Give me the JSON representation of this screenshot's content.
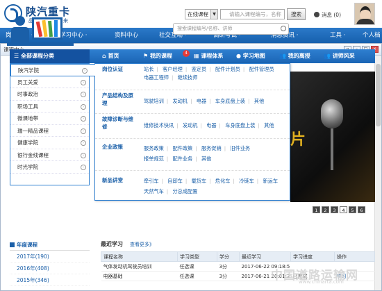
{
  "header": {
    "brand": "陕汽重卡",
    "slogan": "品质成就未来",
    "search_scope": "在线课程",
    "search_placeholder": "请输入课程编号，名称",
    "search_button": "搜索",
    "messages_label": "消息 (0)"
  },
  "nav": [
    "岗位认证 ·",
    "学习中心 ·",
    "资料中心",
    "社交互动 ·",
    "调研考试 ·",
    "消息资讯 ·",
    "工具 ·",
    "个人档"
  ],
  "window": {
    "title": "课程中心"
  },
  "course_search": {
    "placeholder": "搜索课程编号/名称、讲师"
  },
  "bar": {
    "category": "全部课程分类",
    "tabs": [
      "首页",
      "我的课程",
      "课程体系",
      "学习地图",
      "我的离授",
      "讲师风采"
    ],
    "badge": "4"
  },
  "sidebar": [
    "陕汽学院",
    "员工关爱",
    "时事政治",
    "职场工具",
    "微课地带",
    "瑞一精品课程",
    "健康学院",
    "银行金线课程",
    "时光学院"
  ],
  "dropdown": [
    {
      "label": "岗位认证",
      "links": [
        "站长",
        "客户经理",
        "鉴定员",
        "配件计划员",
        "配件管理员",
        "电器工程师",
        "继续技师"
      ]
    },
    {
      "label": "产品结构及原理",
      "links": [
        "驾驶培训",
        "发动机",
        "电器",
        "车身底盘上装",
        "其他"
      ]
    },
    {
      "label": "故障诊断与维修",
      "links": [
        "维修技术快讯",
        "发动机",
        "电器",
        "车身底盘上装",
        "其他"
      ]
    },
    {
      "label": "企业政策",
      "links": [
        "服务政策",
        "配件政策",
        "服务促销",
        "旧件业务",
        "报单规范",
        "配件业务",
        "其他"
      ]
    },
    {
      "label": "新品讲堂",
      "links": [
        "牵引车",
        "自卸车",
        "载货车",
        "危化车",
        "冷链车",
        "新运车",
        "天然气车",
        "分总成配置"
      ]
    }
  ],
  "pager": [
    "1",
    "2",
    "3",
    "4",
    "5",
    "6"
  ],
  "years": {
    "heading": "年度课程",
    "items": [
      "2017年(190)",
      "2016年(408)",
      "2015年(346)"
    ]
  },
  "recent": {
    "heading": "最近学习",
    "more": "查看更多》",
    "columns": [
      "课程名称",
      "学习类型",
      "学分",
      "最近学习",
      "学习进度",
      "操作"
    ],
    "rows": [
      [
        "气体发动机驾驶员培训",
        "任选课",
        "3分",
        "2017-06-22 09:18:5",
        "",
        ""
      ],
      [
        "电器基础",
        "任选课",
        "3分",
        "2017-06-21 20:01:2",
        "已完成",
        "学习"
      ]
    ]
  },
  "watermark": {
    "text": "中国道路运输网",
    "url": "www.chinarta.com"
  },
  "colors": {
    "primary": "#1a65b5",
    "badge": "#e53935"
  }
}
